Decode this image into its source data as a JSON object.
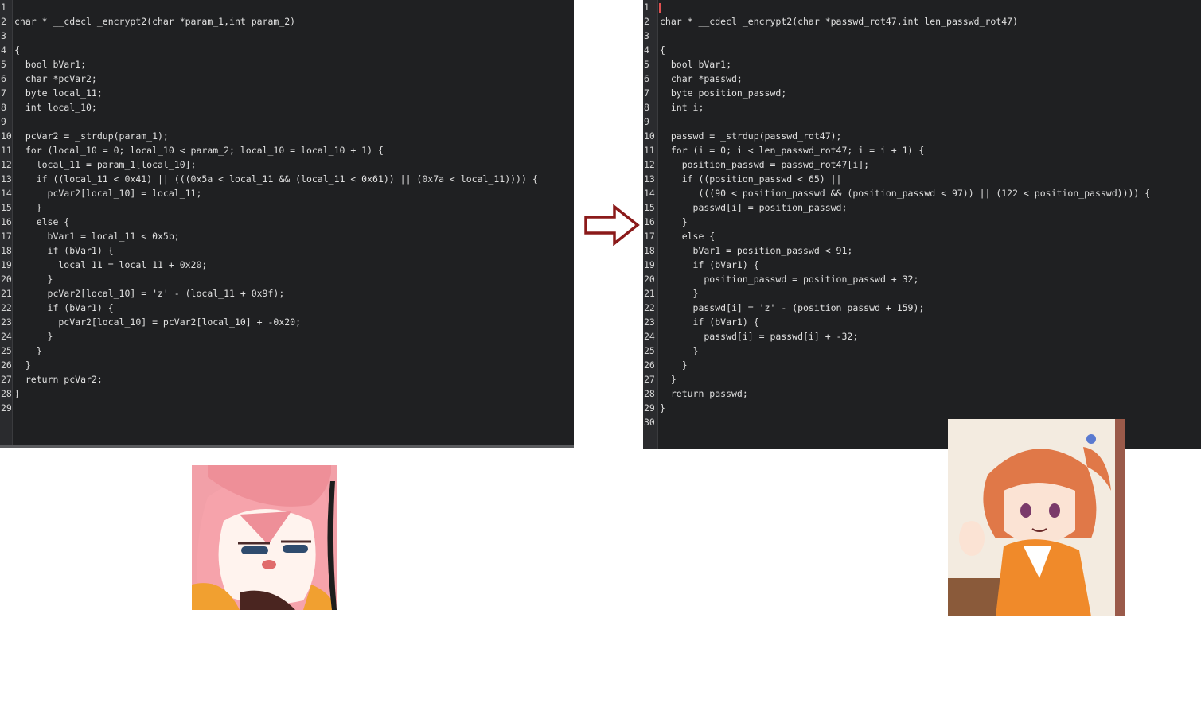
{
  "left_panel": {
    "lines": [
      "",
      "char * __cdecl _encrypt2(char *param_1,int param_2)",
      "",
      "{",
      "  bool bVar1;",
      "  char *pcVar2;",
      "  byte local_11;",
      "  int local_10;",
      "",
      "  pcVar2 = _strdup(param_1);",
      "  for (local_10 = 0; local_10 < param_2; local_10 = local_10 + 1) {",
      "    local_11 = param_1[local_10];",
      "    if ((local_11 < 0x41) || (((0x5a < local_11 && (local_11 < 0x61)) || (0x7a < local_11)))) {",
      "      pcVar2[local_10] = local_11;",
      "    }",
      "    else {",
      "      bVar1 = local_11 < 0x5b;",
      "      if (bVar1) {",
      "        local_11 = local_11 + 0x20;",
      "      }",
      "      pcVar2[local_10] = 'z' - (local_11 + 0x9f);",
      "      if (bVar1) {",
      "        pcVar2[local_10] = pcVar2[local_10] + -0x20;",
      "      }",
      "    }",
      "  }",
      "  return pcVar2;",
      "}",
      ""
    ]
  },
  "right_panel": {
    "lines": [
      "",
      "char * __cdecl _encrypt2(char *passwd_rot47,int len_passwd_rot47)",
      "",
      "{",
      "  bool bVar1;",
      "  char *passwd;",
      "  byte position_passwd;",
      "  int i;",
      "",
      "  passwd = _strdup(passwd_rot47);",
      "  for (i = 0; i < len_passwd_rot47; i = i + 1) {",
      "    position_passwd = passwd_rot47[i];",
      "    if ((position_passwd < 65) ||",
      "       (((90 < position_passwd && (position_passwd < 97)) || (122 < position_passwd)))) {",
      "      passwd[i] = position_passwd;",
      "    }",
      "    else {",
      "      bVar1 = position_passwd < 91;",
      "      if (bVar1) {",
      "        position_passwd = position_passwd + 32;",
      "      }",
      "      passwd[i] = 'z' - (position_passwd + 159);",
      "      if (bVar1) {",
      "        passwd[i] = passwd[i] + -32;",
      "      }",
      "    }",
      "  }",
      "  return passwd;",
      "}",
      ""
    ]
  },
  "arrow": {
    "icon": "right-arrow-icon",
    "color": "#8b1a1a"
  },
  "stickers": {
    "left": "pink-hair-sleepy-anime-sticker",
    "right": "orange-hair-thumbs-up-anime-sticker"
  }
}
